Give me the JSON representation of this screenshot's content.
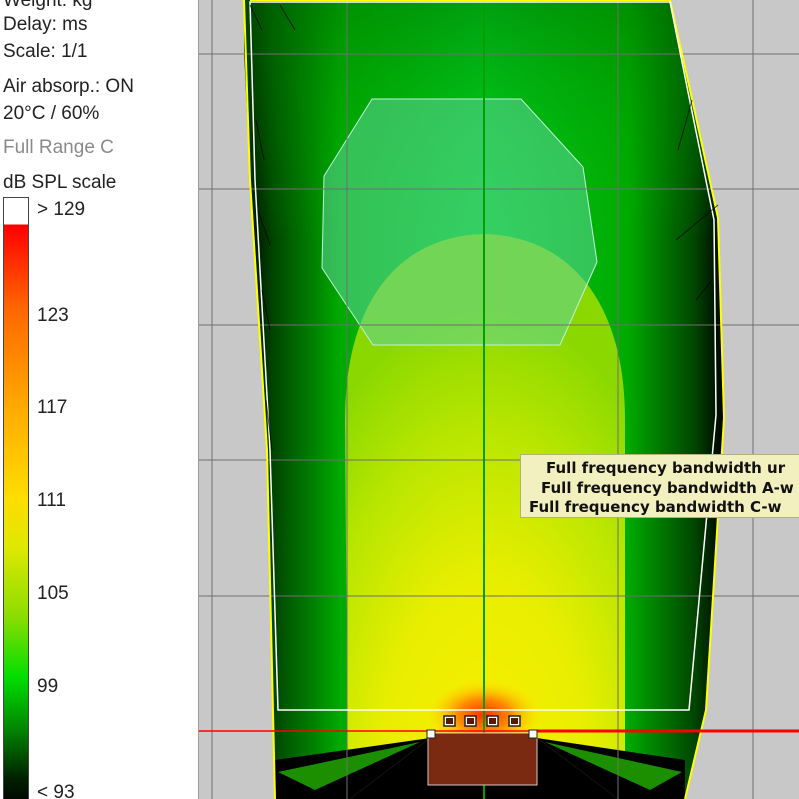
{
  "sidebar": {
    "weight": "Weight: kg",
    "delay": "Delay: ms",
    "scale": "Scale: 1/1",
    "air_absorption": "Air absorp.: ON",
    "conditions": "20°C / 60%",
    "filter": "Full Range C",
    "scale_title": "dB SPL scale",
    "scale_ticks": [
      "> 129",
      "123",
      "117",
      "111",
      "105",
      "99",
      "< 93"
    ]
  },
  "tooltip": {
    "lines": [
      "Full frequency bandwidth ur",
      "Full frequency bandwidth A-w",
      "Full frequency bandwidth C-w"
    ]
  },
  "colors": {
    "scale_gradient": [
      "#ffffff",
      "#ff0000",
      "#ff9900",
      "#ffcc00",
      "#ffee00",
      "#88dd00",
      "#00dd00",
      "#000000"
    ],
    "reference_line": "#ff0000",
    "stage": "#7a2a10",
    "grid": "#6f6f6f",
    "venue_outline": "#ffff00",
    "audience_zone": "#ffffff",
    "tooltip_bg": "#f3f0bf"
  }
}
